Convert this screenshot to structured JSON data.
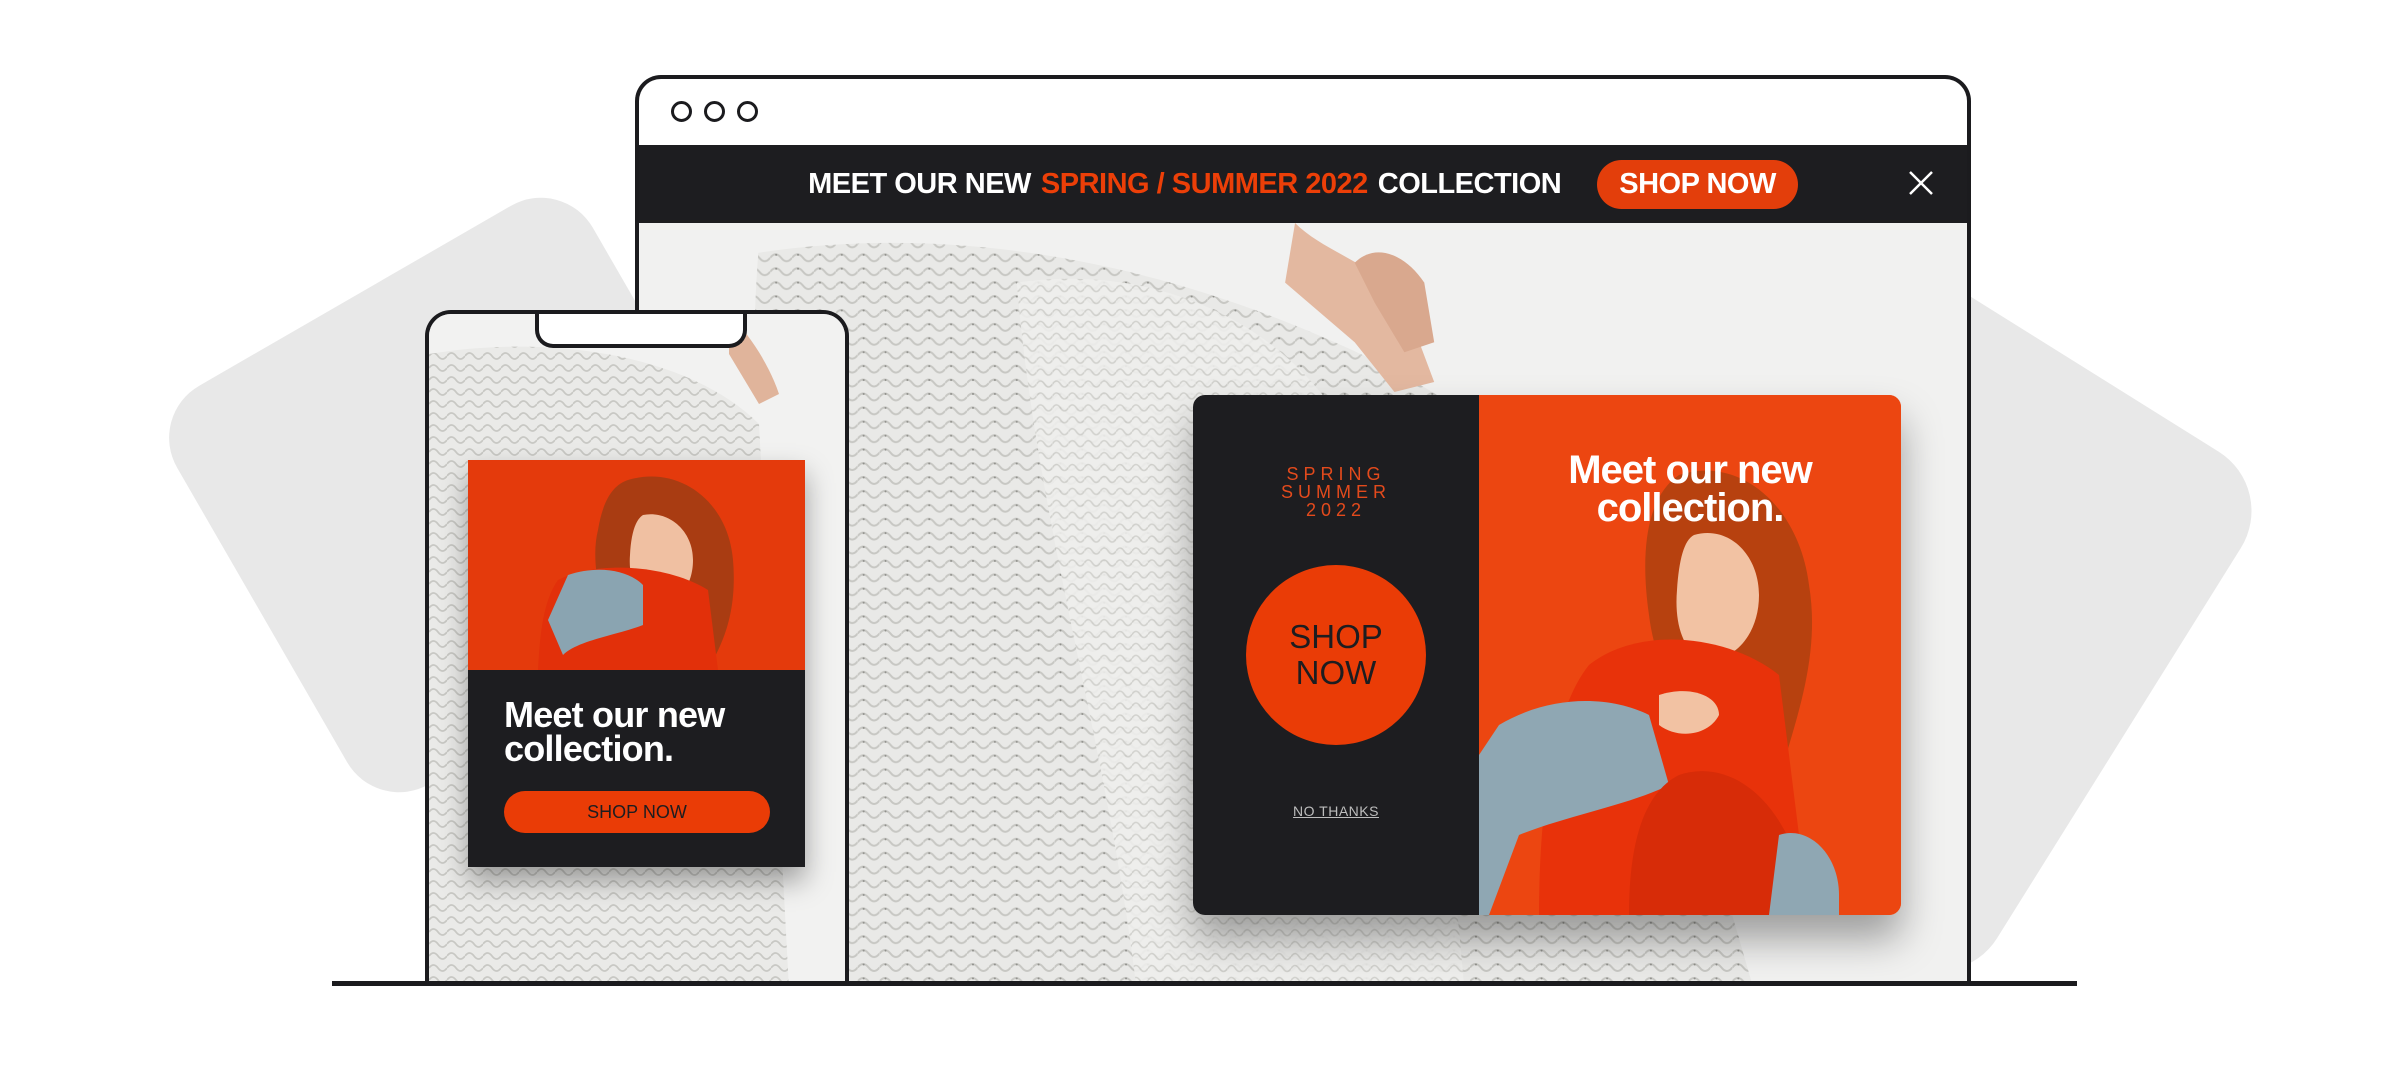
{
  "colors": {
    "accent": "#ec3f08",
    "dark": "#1d1d20",
    "background_shape": "#e8e8e8"
  },
  "banner": {
    "text_prefix": "MEET OUR NEW",
    "text_highlight": "SPRING / SUMMER 2022",
    "text_suffix": "COLLECTION",
    "button_label": "SHOP NOW",
    "close_icon": "close-icon"
  },
  "popup": {
    "season_line1": "SPRING",
    "season_line2": "SUMMER",
    "season_line3": "2022",
    "cta_line1": "SHOP",
    "cta_line2": "NOW",
    "decline_label": "NO THANKS",
    "title_line1": "Meet our new",
    "title_line2": "collection."
  },
  "mobile": {
    "title_line1": "Meet our new",
    "title_line2": "collection.",
    "button_label": "SHOP NOW"
  }
}
